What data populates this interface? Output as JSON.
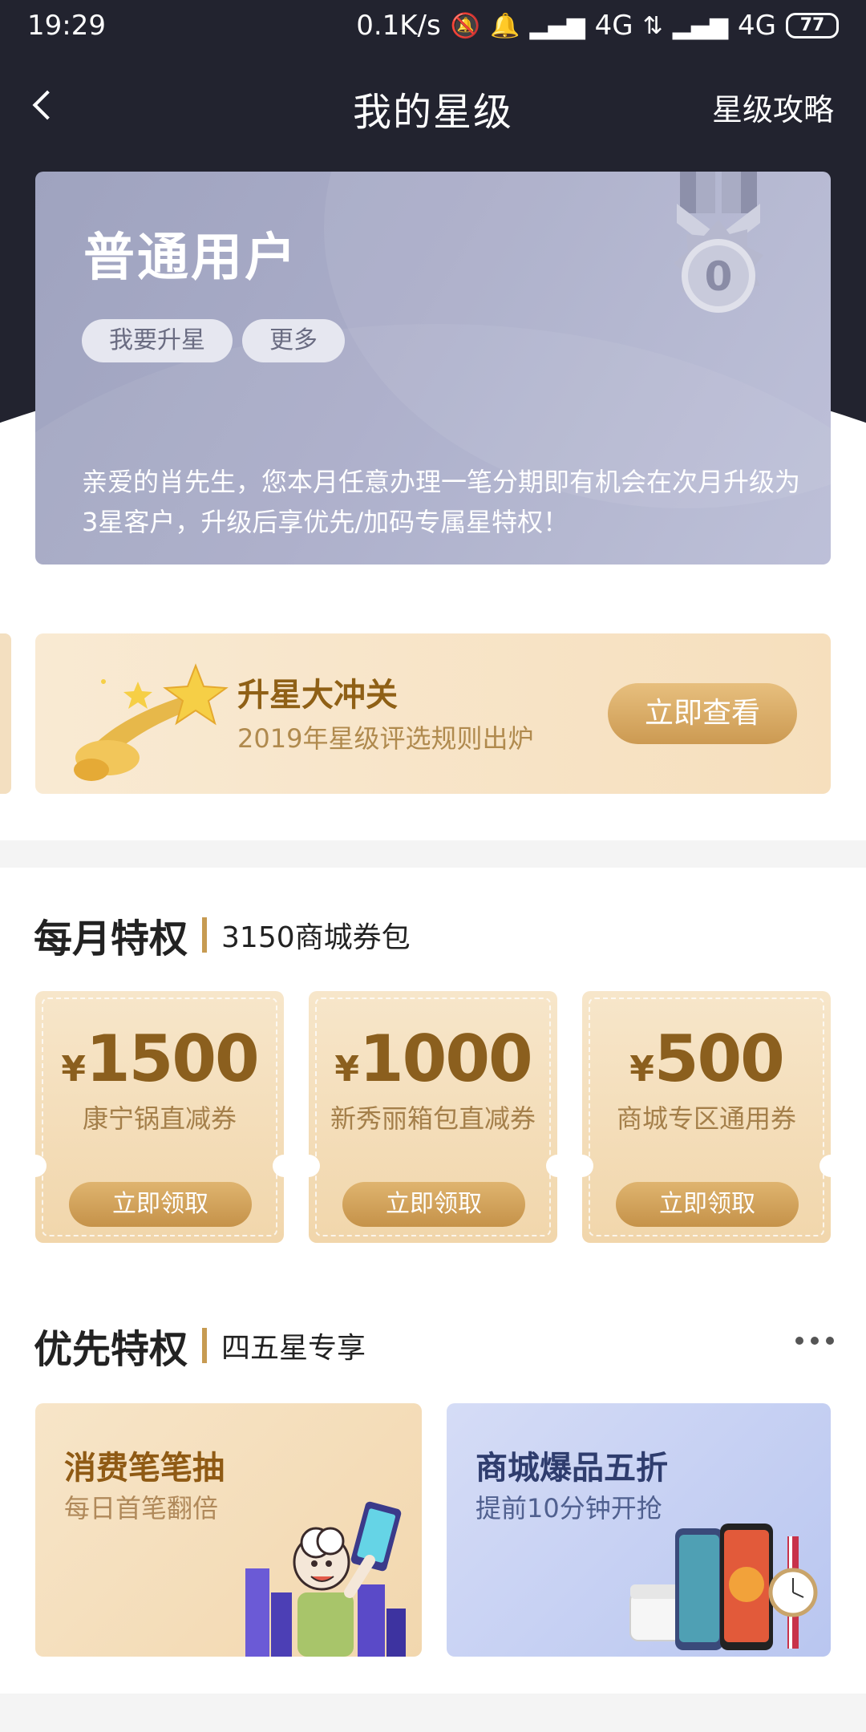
{
  "status_bar": {
    "time": "19:29",
    "network_speed": "0.1K/s",
    "signal1": "4G",
    "signal2": "4G",
    "battery": "77"
  },
  "header": {
    "title": "我的星级",
    "right_link": "星级攻略"
  },
  "member_card": {
    "level_name": "普通用户",
    "level_number": "0",
    "btn_upgrade": "我要升星",
    "btn_more": "更多",
    "description": "亲爱的肖先生，您本月任意办理一笔分期即有机会在次月升级为3星客户，升级后享优先/加码专属星特权！"
  },
  "banner": {
    "title": "升星大冲关",
    "subtitle": "2019年星级评选规则出炉",
    "button": "立即查看"
  },
  "monthly": {
    "title": "每月特权",
    "subtitle": "3150商城券包",
    "coupons": [
      {
        "currency": "¥",
        "amount": "1500",
        "name": "康宁锅直减券",
        "button": "立即领取"
      },
      {
        "currency": "¥",
        "amount": "1000",
        "name": "新秀丽箱包直减券",
        "button": "立即领取"
      },
      {
        "currency": "¥",
        "amount": "500",
        "name": "商城专区通用券",
        "button": "立即领取"
      }
    ]
  },
  "priority": {
    "title": "优先特权",
    "subtitle": "四五星专享",
    "cards": [
      {
        "title": "消费笔笔抽",
        "subtitle": "每日首笔翻倍"
      },
      {
        "title": "商城爆品五折",
        "subtitle": "提前10分钟开抢"
      }
    ]
  },
  "colors": {
    "header_bg": "#22232f",
    "gold": "#c79b52",
    "card_gray": "#a9acc8"
  }
}
